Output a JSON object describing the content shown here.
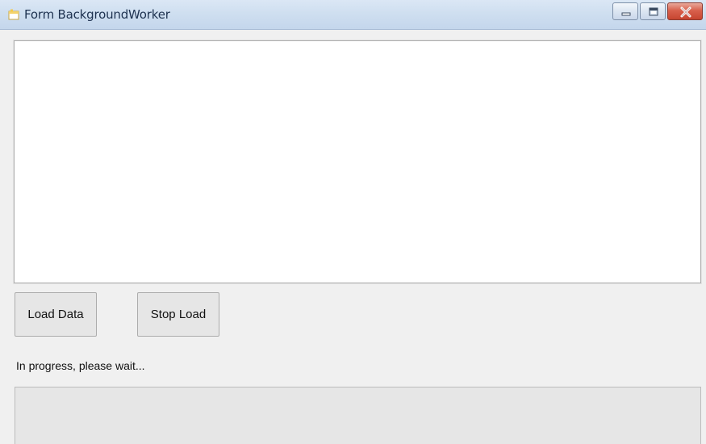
{
  "window": {
    "title": "Form BackgroundWorker"
  },
  "caption_buttons": {
    "minimize_icon": "minimize-icon",
    "maximize_icon": "maximize-icon",
    "close_icon": "close-icon",
    "close_color": "#c64530"
  },
  "textbox": {
    "value": ""
  },
  "buttons": {
    "load_label": "Load Data",
    "stop_label": "Stop Load"
  },
  "status": {
    "text": "In progress, please wait..."
  },
  "progress": {
    "value_percent": 0
  }
}
